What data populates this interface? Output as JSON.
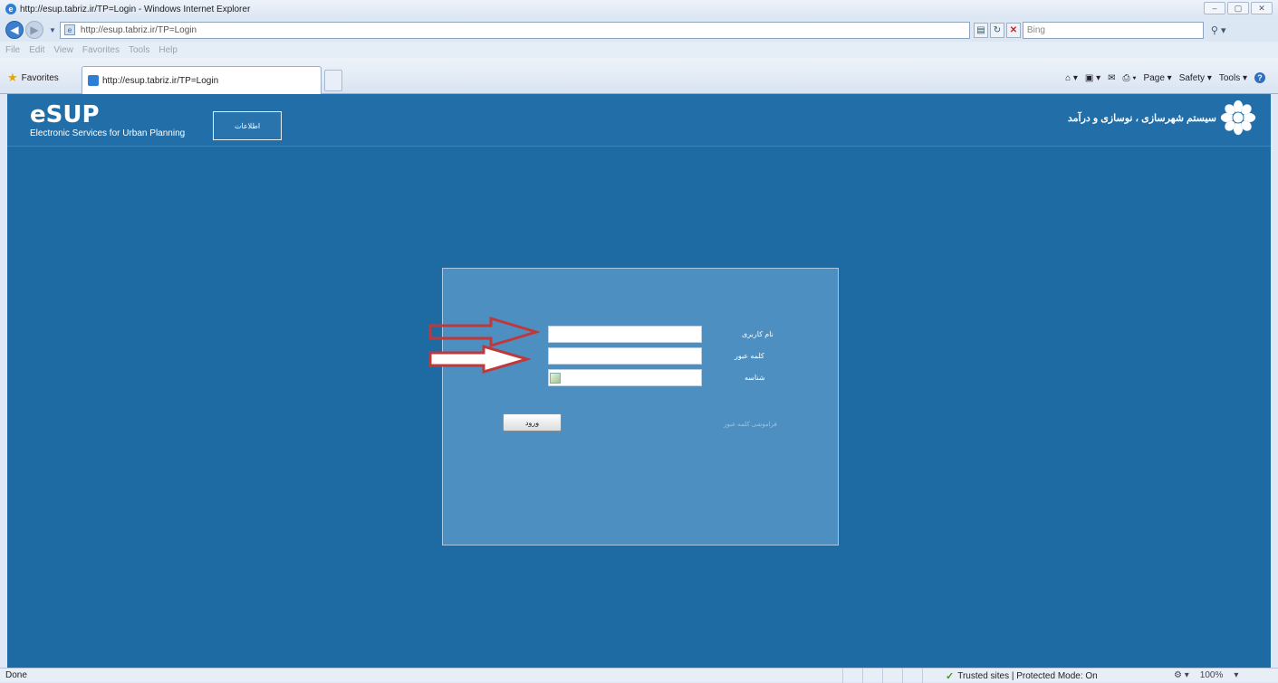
{
  "browser": {
    "window_title": "http://esup.tabriz.ir/TP=Login - Windows Internet Explorer",
    "address": "http://esup.tabriz.ir/TP=Login",
    "search_placeholder": "Bing",
    "menu": [
      "File",
      "Edit",
      "View",
      "Favorites",
      "Tools",
      "Help"
    ],
    "favorites_label": "Favorites",
    "tab_title": "http://esup.tabriz.ir/TP=Login",
    "commands": [
      "Page ▾",
      "Safety ▾",
      "Tools ▾"
    ]
  },
  "site": {
    "logo": "eSUP",
    "subtitle": "Electronic Services for Urban Planning",
    "header_button": "اطلاعات",
    "title": "سیستم شهرسازی ، نوسازی و درآمد",
    "accent_color": "#1e6ba4"
  },
  "login": {
    "username_label": "نام کاربری",
    "password_label": "کلمه عبور",
    "captcha_label": "شناسه",
    "username_value": "",
    "password_value": "",
    "captcha_value": "",
    "submit_label": "ورود",
    "forgot_label": "فراموشی کلمه عبور"
  },
  "status": {
    "left": "Done",
    "zone": "Trusted sites | Protected Mode: On",
    "zoom": "100%"
  }
}
